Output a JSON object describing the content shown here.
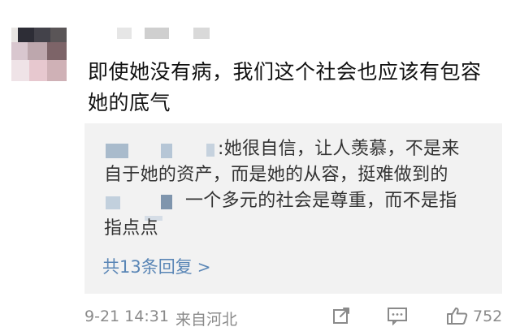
{
  "comment": {
    "text_line1": "即使她没有病，我们这个社会也应该有包容",
    "text_line2": "她的底气"
  },
  "reply": {
    "line1_suffix": ":她很自信，让人羡慕，不是来",
    "line2": "自于她的资产，而是她的从容，挺难做到的",
    "line3_suffix": "一个多元的社会是尊重，而不是指",
    "line4": "指点点",
    "more_label": "共13条回复",
    "more_chevron": ">"
  },
  "footer": {
    "time": "9-21 14:31",
    "location": "来自河北",
    "like_count": "752",
    "icons": [
      "share-icon",
      "comment-icon",
      "like-icon"
    ]
  },
  "colors": {
    "link": "#5a86b6",
    "meta": "#8a8a8a",
    "reply_bg": "#f2f2f2",
    "mask": "#9fb3c8"
  }
}
